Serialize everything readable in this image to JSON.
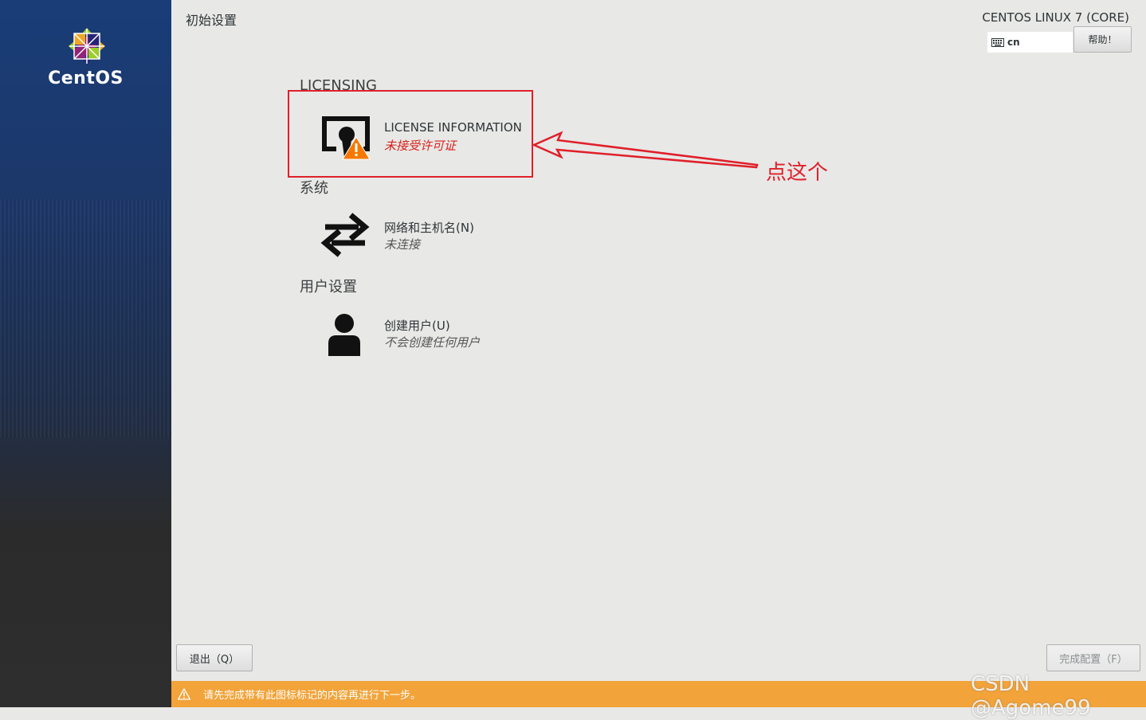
{
  "sidebar": {
    "logo_text": "CentOS"
  },
  "header": {
    "page_title": "初始设置",
    "product_title": "CENTOS LINUX 7 (CORE)",
    "keyboard_layout": "cn",
    "help_label": "帮助！"
  },
  "sections": [
    {
      "heading": "LICENSING",
      "spokes": [
        {
          "title": "LICENSE INFORMATION",
          "status": "未接受许可证",
          "icon": "license-warning-icon",
          "status_color": "#d8221b"
        }
      ]
    },
    {
      "heading": "系统",
      "spokes": [
        {
          "title": "网络和主机名(N)",
          "status": "未连接",
          "icon": "network-arrows-icon"
        }
      ]
    },
    {
      "heading": "用户设置",
      "spokes": [
        {
          "title": "创建用户(U)",
          "status": "不会创建任何用户",
          "icon": "user-icon"
        }
      ]
    }
  ],
  "annotation": {
    "text": "点这个",
    "color": "#e0202a"
  },
  "footer": {
    "quit_label": "退出（Q）",
    "done_label": "完成配置（F）",
    "warning_text": "请先完成带有此图标标记的内容再进行下一步。",
    "warning_color": "#f2a339"
  },
  "watermark": "CSDN @Agome99"
}
